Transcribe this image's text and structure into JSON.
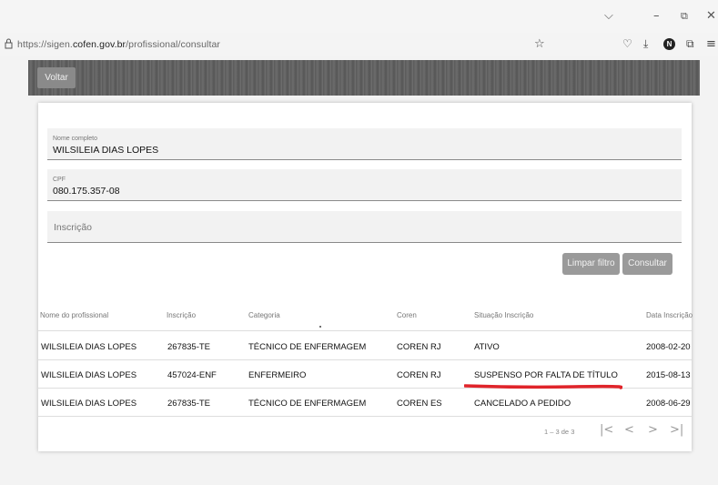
{
  "browser": {
    "url_prefix": "https://sigen.",
    "url_domain": "cofen.gov.br",
    "url_path": "/profissional/consultar",
    "icons": [
      "chevron-down-icon",
      "minimize-icon",
      "restore-icon",
      "close-icon",
      "lock-icon",
      "star-icon",
      "pocket-icon",
      "download-icon",
      "profile-icon",
      "extensions-icon",
      "menu-icon"
    ],
    "profile_initial": "N"
  },
  "header": {
    "back_label": "Voltar"
  },
  "form": {
    "nome": {
      "label": "Nome completo",
      "value": "WILSILEIA DIAS LOPES"
    },
    "cpf": {
      "label": "CPF",
      "value": "080.175.357-08"
    },
    "inscricao": {
      "placeholder": "Inscrição"
    },
    "clear_label": "Limpar filtro",
    "submit_label": "Consultar"
  },
  "table": {
    "columns": [
      "Nome do profissional",
      "Inscrição",
      "Categoria",
      "Coren",
      "Situação Inscrição",
      "Data Inscrição"
    ],
    "rows": [
      [
        "WILSILEIA DIAS LOPES",
        "267835-TE",
        "TÉCNICO DE ENFERMAGEM",
        "COREN RJ",
        "ATIVO",
        "2008-02-20"
      ],
      [
        "WILSILEIA DIAS LOPES",
        "457024-ENF",
        "ENFERMEIRO",
        "COREN RJ",
        "SUSPENSO POR FALTA DE TÍTULO",
        "2015-08-13"
      ],
      [
        "WILSILEIA DIAS LOPES",
        "267835-TE",
        "TÉCNICO DE ENFERMAGEM",
        "COREN ES",
        "CANCELADO A PEDIDO",
        "2008-06-29"
      ]
    ],
    "highlight_color": "#e0242a"
  },
  "pagination": {
    "range_text": "1 – 3 de 3",
    "icons": [
      "first-page-icon",
      "previous-page-icon",
      "next-page-icon",
      "last-page-icon"
    ]
  }
}
